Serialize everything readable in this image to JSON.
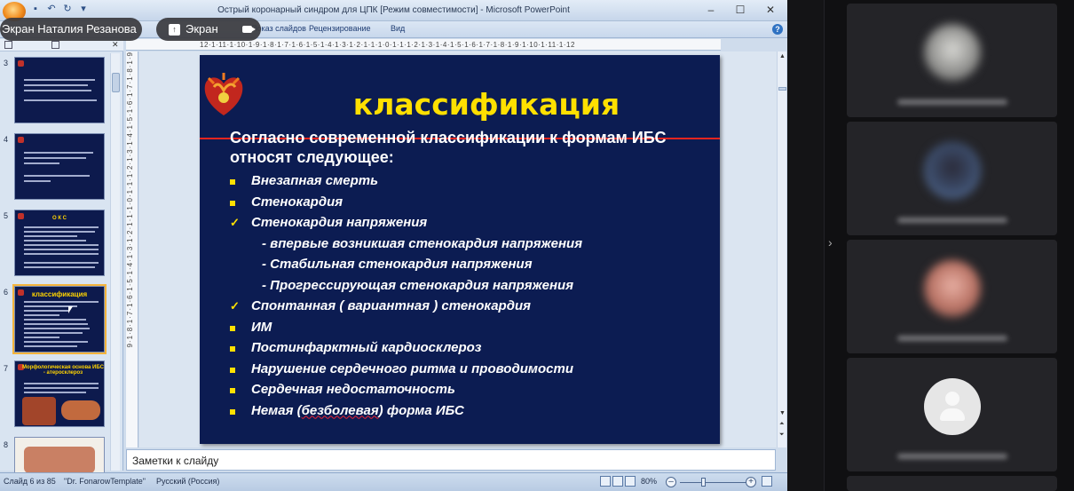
{
  "window": {
    "title": "Острый коронарный синдром  для ЦПК [Режим совместимости] - Microsoft PowerPoint"
  },
  "ribbon": {
    "tabs": [
      "Показ слайдов",
      "Рецензирование",
      "Вид"
    ]
  },
  "ruler": {
    "horizontal": "12·1·11·1·10·1·9·1·8·1·7·1·6·1·5·1·4·1·3·1·2·1·1·1·0·1·1·1·2·1·3·1·4·1·5·1·6·1·7·1·8·1·9·1·10·1·11·1·12",
    "vertical": "9·1·8·1·7·1·6·1·5·1·4·1·3·1·2·1·1·1·0·1·1·1·2·1·3·1·4·1·5·1·6·1·7·1·8·1·9"
  },
  "thumbnails": [
    {
      "num": "3",
      "title": ""
    },
    {
      "num": "4",
      "title": ""
    },
    {
      "num": "5",
      "title": "О К С"
    },
    {
      "num": "6",
      "title": "классификация"
    },
    {
      "num": "7",
      "title": "Морфологическая основа ИБС - атеросклероз"
    },
    {
      "num": "8",
      "title": ""
    }
  ],
  "slide": {
    "title": "классификация",
    "intro": [
      "Согласно современной классификации к формам ИБС",
      "относят следующее:"
    ],
    "items": [
      {
        "marker": "square",
        "text": "Внезапная смерть"
      },
      {
        "marker": "square",
        "text": "Стенокардия"
      },
      {
        "marker": "check",
        "text": "Стенокардия напряжения"
      },
      {
        "marker": "none",
        "text": "- впервые возникшая стенокардия напряжения"
      },
      {
        "marker": "none",
        "text": "- Стабильная стенокардия напряжения"
      },
      {
        "marker": "none",
        "text": "- Прогрессирующая  стенокардия напряжения"
      },
      {
        "marker": "check",
        "text": "Спонтанная ( вариантная ) стенокардия"
      },
      {
        "marker": "square",
        "text": "ИМ"
      },
      {
        "marker": "square",
        "text": "Постинфарктный кардиосклероз"
      },
      {
        "marker": "square",
        "text": "Нарушение сердечного  ритма и проводимости"
      },
      {
        "marker": "square",
        "text": "Сердечная недостаточность"
      },
      {
        "marker": "square",
        "text_before": "Немая (",
        "text_squiggle": "безболевая",
        "text_after": ") форма ИБС"
      }
    ]
  },
  "notes": {
    "placeholder": "Заметки к слайду"
  },
  "statusbar": {
    "slide_counter": "Слайд 6 из 85",
    "template": "\"Dr. FonarowTemplate\"",
    "language": "Русский (Россия)",
    "zoom": "80%"
  },
  "overlay": {
    "presenter": "Экран Наталия Резанова",
    "screen_label": "Экран"
  },
  "colors": {
    "slide_bg": "#0c1c52",
    "title": "#ffe000",
    "accent_line": "#e8251f"
  }
}
